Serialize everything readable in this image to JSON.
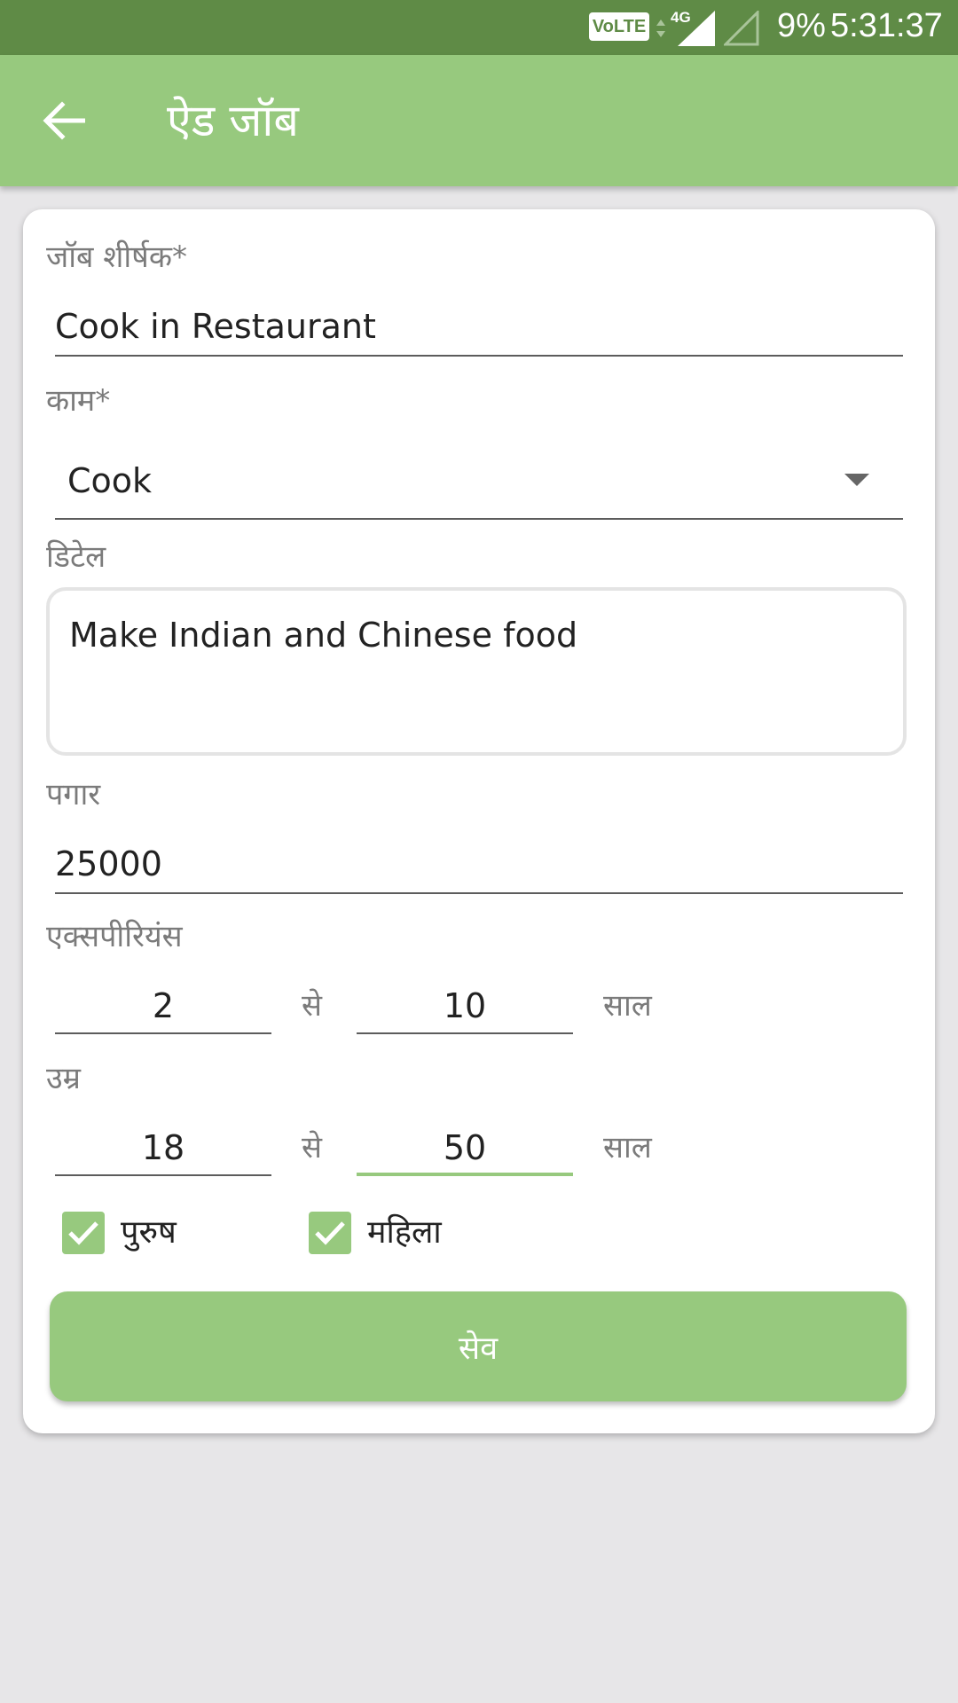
{
  "status_bar": {
    "volte": "VoLTE",
    "network": "4G",
    "battery": "9%",
    "time": "5:31:37"
  },
  "app_bar": {
    "title": "ऐड जॉब",
    "back_icon": "arrow-back-icon"
  },
  "form": {
    "job_title": {
      "label": "जॉब शीर्षक*",
      "value": "Cook in Restaurant"
    },
    "work": {
      "label": "काम*",
      "value": "Cook",
      "icon": "dropdown-arrow-icon"
    },
    "detail": {
      "label": "डिटेल",
      "value": "Make Indian and Chinese food"
    },
    "salary": {
      "label": "पगार",
      "value": "25000"
    },
    "experience": {
      "label": "एक्सपीरियंस",
      "from": "2",
      "separator": "से",
      "to": "10",
      "unit": "साल"
    },
    "age": {
      "label": "उम्र",
      "from": "18",
      "separator": "से",
      "to": "50",
      "unit": "साल"
    },
    "gender": {
      "male": {
        "label": "पुरुष",
        "checked": true
      },
      "female": {
        "label": "महिला",
        "checked": true
      }
    },
    "save_label": "सेव"
  },
  "colors": {
    "status_bar": "#5f8b46",
    "accent": "#97c97e",
    "background": "#e7e6e8"
  }
}
